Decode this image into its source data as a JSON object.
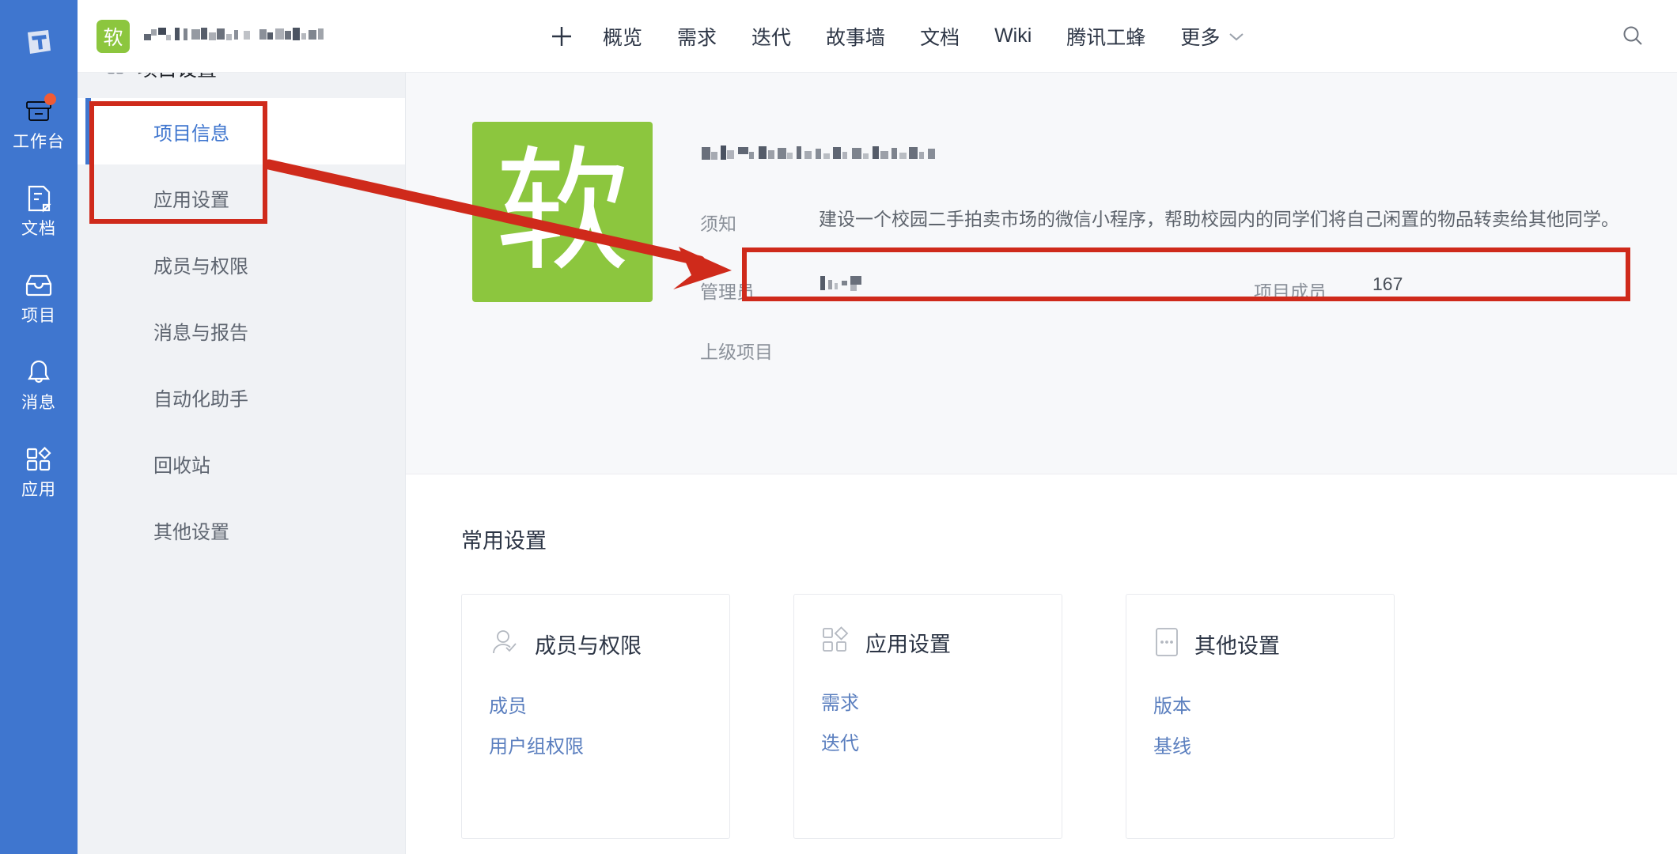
{
  "colors": {
    "rail_bg": "#3f76cf",
    "accent_blue": "#3f76cf",
    "link_blue": "#5b7fbf",
    "avatar_green": "#8cc63e",
    "annotation_red": "#cf2a1b",
    "badge_orange": "#f05b35",
    "panel_gray": "#f0f2f5",
    "info_gray": "#f7f8fa"
  },
  "rail": {
    "logo_name": "tapd-logo-icon",
    "items": [
      {
        "label": "工作台",
        "icon": "workbench-icon",
        "badge": true
      },
      {
        "label": "文档",
        "icon": "document-icon",
        "badge": false
      },
      {
        "label": "项目",
        "icon": "project-inbox-icon",
        "badge": false
      },
      {
        "label": "消息",
        "icon": "bell-icon",
        "badge": false
      },
      {
        "label": "应用",
        "icon": "apps-icon",
        "badge": false
      }
    ]
  },
  "topbar": {
    "project_avatar_text": "软",
    "project_name_redacted": true,
    "add_icon": "plus-icon",
    "search_icon": "search-icon",
    "nav": [
      {
        "label": "概览"
      },
      {
        "label": "需求"
      },
      {
        "label": "迭代"
      },
      {
        "label": "故事墙"
      },
      {
        "label": "文档"
      },
      {
        "label": "Wiki"
      },
      {
        "label": "腾讯工蜂"
      }
    ],
    "more_label": "更多",
    "more_icon": "chevron-down-icon"
  },
  "settings_panel": {
    "header": {
      "label": "项目设置",
      "icon": "apps-grid-icon"
    },
    "items": [
      {
        "label": "项目信息",
        "active": true
      },
      {
        "label": "应用设置",
        "active": false
      },
      {
        "label": "成员与权限",
        "active": false
      },
      {
        "label": "消息与报告",
        "active": false
      },
      {
        "label": "自动化助手",
        "active": false
      },
      {
        "label": "回收站",
        "active": false
      },
      {
        "label": "其他设置",
        "active": false
      }
    ]
  },
  "project_info": {
    "logo_text": "软",
    "title_redacted": true,
    "description_label": "须知",
    "description": "建设一个校园二手拍卖市场的微信小程序，帮助校园内的同学们将自己闲置的物品转卖给其他同学。",
    "admin_label": "管理员",
    "admin_value_redacted": true,
    "members_label": "项目成员",
    "members_value": "167",
    "parent_label": "上级项目",
    "parent_value": ""
  },
  "common_settings": {
    "title": "常用设置",
    "cards": [
      {
        "title": "成员与权限",
        "icon": "user-check-icon",
        "links": [
          "成员",
          "用户组权限"
        ]
      },
      {
        "title": "应用设置",
        "icon": "apps-grid-icon",
        "links": [
          "需求",
          "迭代"
        ]
      },
      {
        "title": "其他设置",
        "icon": "more-dots-icon",
        "links": [
          "版本",
          "基线"
        ]
      }
    ]
  },
  "annotations": {
    "box_sidebar": "项目设置 / 项目信息 高亮框",
    "box_description": "项目描述 高亮框",
    "arrow": "红色箭头 指向 项目描述"
  }
}
